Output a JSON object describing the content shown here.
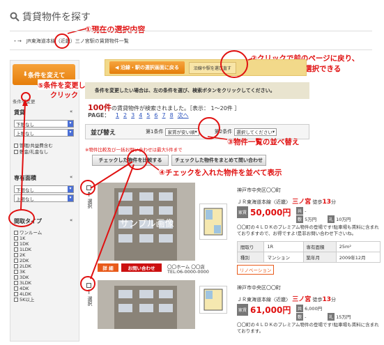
{
  "page": {
    "title": "賃貸物件を探す"
  },
  "breadcrumb": {
    "text": "JR東海道本線（近畿）三ノ宮駅の賃貸物件一覧"
  },
  "annotations": {
    "a1": "①現在の選択内容",
    "a2_line1": "②クリックで前のページに戻り、",
    "a2_line2": "沿線や駅を再選択できる",
    "a3": "③物件一覧の並べ替え",
    "a4": "④チェックを入れた物件を並べて表示",
    "a5_line1": "⑤条件を変更して",
    "a5_line2": "クリック"
  },
  "sidebar": {
    "change_button": "条件を変えて",
    "caption": "条件を変更",
    "rent_label": "賃貸",
    "rent_min": "下限なし",
    "rent_max": "上限なし",
    "fee_opt1": "管理/共益費含む",
    "fee_opt2": "敷金/礼金なし",
    "area_label": "専有面積",
    "area_min": "下限なし",
    "area_max": "上限なし",
    "layout_label": "間取タイプ",
    "layouts": [
      "ワンルーム",
      "1K",
      "1DK",
      "1LDK",
      "2K",
      "2DK",
      "2LDK",
      "3K",
      "3DK",
      "3LDK",
      "4DK",
      "4LDK",
      "5K以上"
    ]
  },
  "back_bar": {
    "button": "沿線・駅の選択画面に戻る",
    "button2": "沿線や駅を選び直す"
  },
  "info_bar": {
    "text": "条件を変更したい場合は、左の条件を選び、検索ボタンをクリックしてください。"
  },
  "results": {
    "count": "100件",
    "count_suffix": "の賃貸物件が検索されました。［表示： 1〜20件 ］",
    "page_label": "PAGE：",
    "pages": [
      "1",
      "2",
      "3",
      "4",
      "5",
      "6",
      "7",
      "8"
    ],
    "next": "次へ"
  },
  "sort": {
    "label": "並び替え",
    "cond1_label": "第1条件",
    "cond1_value": "家賃が安い順",
    "cond2_label": "第2条件",
    "cond2_value": "選択してください"
  },
  "compare": {
    "note": "※物件比較及び一括お問い合わせは最大5件まで",
    "btn1": "チェックした物件を比較する",
    "btn2": "チェックした物件をまとめて問い合わせ"
  },
  "listings": [
    {
      "select_label": "選択",
      "address": "神戸市中央区〇〇町",
      "line": "ＪＲ東海道本線〈近畿〉",
      "station": "三ノ宮",
      "walk_prefix": "徒歩",
      "walk": "13",
      "walk_unit": "分",
      "rent_tag": "家賃",
      "rent": "50,000円",
      "common_tag": "共",
      "common": "-",
      "deposit_tag": "敷",
      "deposit": "5万円",
      "key_tag": "礼",
      "key": "10万円",
      "photo_text": "サンプル画像",
      "detail_btn": "詳 細",
      "inquiry_btn": "お問い合わせ",
      "agent": "〇〇ホーム 〇〇店",
      "tel": "TEL:06-0000-0000",
      "desc": "〇〇町の４ＬＤＫのプレミアム物件の登場です!駐車場も賃料に含まれておりますので、お得ですよ!是非お問い合わせ下さいね。",
      "table": [
        [
          "間取り",
          "1R",
          "専有面積",
          "25m²"
        ],
        [
          "種別",
          "マンション",
          "築年月",
          "2009年12月"
        ]
      ],
      "tag": "リノベーション"
    },
    {
      "select_label": "選択",
      "address": "神戸市中央区〇〇町",
      "line": "ＪＲ東海道本線〈近畿〉",
      "station": "三ノ宮",
      "walk_prefix": "徒歩",
      "walk": "13",
      "walk_unit": "分",
      "rent_tag": "家賃",
      "rent": "61,000円",
      "common_tag": "共",
      "common": "6,000円",
      "deposit_tag": "敷",
      "deposit": "-",
      "key_tag": "礼",
      "key": "15万円",
      "desc": "〇〇町の４ＬＤＫのプレミアム物件の登場です!駐車場も賃料に含まれております。"
    }
  ],
  "colors": {
    "accent_orange": "#e67e0b",
    "annotation_red": "#e01010",
    "info_bar": "#e9e4cf",
    "back_bar": "#f2d98a"
  }
}
